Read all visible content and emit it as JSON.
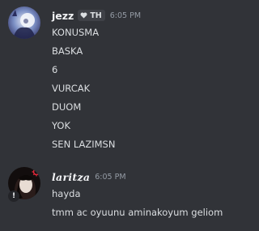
{
  "messages": [
    {
      "author": "jezz",
      "tag": "TH",
      "time": "6:05 PM",
      "lines": [
        "KONUSMA",
        "BASKA",
        "6",
        "VURCAK",
        "DUOM",
        "YOK",
        "SEN LAZIMSN"
      ]
    },
    {
      "author": "laritza",
      "time": "6:05 PM",
      "badge_text": "!",
      "lines": [
        "hayda",
        "tmm ac oyuunu aminakoyum geliom"
      ]
    }
  ],
  "colors": {
    "background": "#313338",
    "username": "#f2f3f5",
    "message_text": "#dbdee1",
    "timestamp": "#949ba4",
    "tag_background": "#3f4147"
  },
  "icons": {
    "tag_icon": "heart-icon",
    "badge_icon": "exclamation-icon"
  }
}
